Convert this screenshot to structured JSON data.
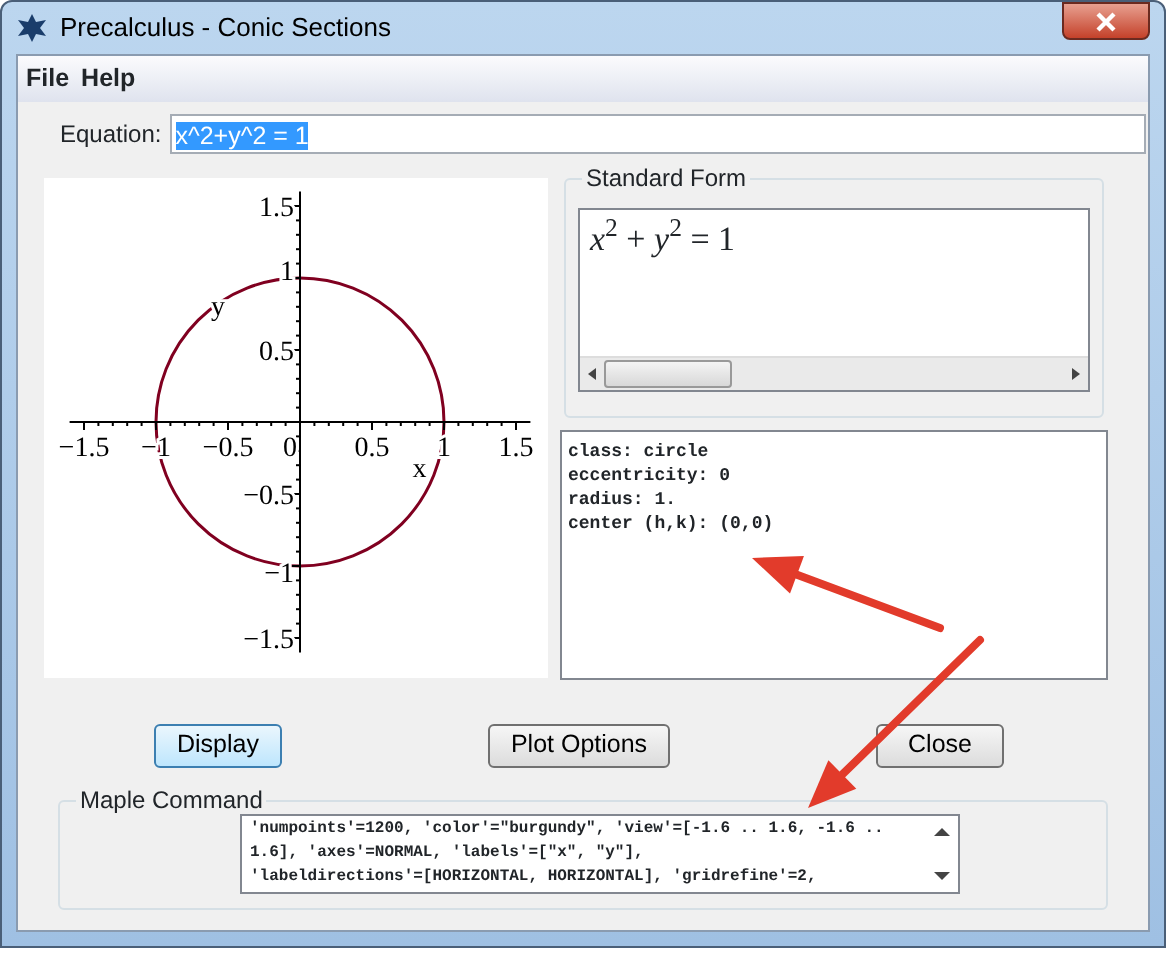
{
  "window": {
    "title": "Precalculus - Conic Sections"
  },
  "menu": [
    {
      "label": "File"
    },
    {
      "label": "Help"
    }
  ],
  "equation": {
    "label": "Equation:",
    "value": "x^2+y^2 = 1",
    "selected": true
  },
  "plot": {
    "chart_data": {
      "type": "line",
      "xlabel": "x",
      "ylabel": "y",
      "xlim": [
        -1.6,
        1.6
      ],
      "ylim": [
        -1.6,
        1.6
      ],
      "xticks": [
        {
          "value": -1.5,
          "label": "−1.5"
        },
        {
          "value": -1,
          "label": "−1"
        },
        {
          "value": -0.5,
          "label": "−0.5"
        },
        {
          "value": 0,
          "label": "0"
        },
        {
          "value": 0.5,
          "label": "0.5"
        },
        {
          "value": 1,
          "label": "1"
        },
        {
          "value": 1.5,
          "label": "1.5"
        }
      ],
      "yticks": [
        {
          "value": -1.5,
          "label": "−1.5"
        },
        {
          "value": -1,
          "label": "−1"
        },
        {
          "value": -0.5,
          "label": "−0.5"
        },
        {
          "value": 0.5,
          "label": "0.5"
        },
        {
          "value": 1,
          "label": "1"
        },
        {
          "value": 1.5,
          "label": "1.5"
        }
      ],
      "title": null
    }
  },
  "standard_form": {
    "title": "Standard Form",
    "formula": "*x*$^{2}$ + *y*$^{2}$ = 1"
  },
  "properties": [
    "class: circle",
    "eccentricity: 0",
    "radius: 1.",
    "center (h,k): (0,0)"
  ],
  "buttons": [
    {
      "label": "Display",
      "default": true
    },
    {
      "label": "Plot Options",
      "default": false
    },
    {
      "label": "Close",
      "default": false
    }
  ],
  "maple_command": {
    "title": "Maple Command",
    "lines": [
      "'numpoints'=1200, 'color'=\"burgundy\", 'view'=[-1.6 .. 1.6, -1.6 ..",
      "1.6], 'axes'=NORMAL, 'labels'=[\"x\", \"y\"],",
      "'labeldirections'=[HORIZONTAL, HORIZONTAL], 'gridrefine'=2,"
    ]
  }
}
